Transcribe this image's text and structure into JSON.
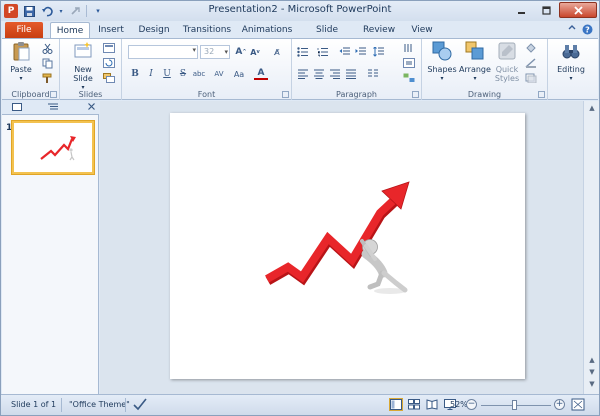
{
  "app": {
    "title": "Presentation2 - Microsoft PowerPoint",
    "logo_letter": "P"
  },
  "tabs": {
    "file": "File",
    "home": "Home",
    "insert": "Insert",
    "design": "Design",
    "transitions": "Transitions",
    "animations": "Animations",
    "slide_show": "Slide Show",
    "review": "Review",
    "view": "View"
  },
  "ribbon": {
    "clipboard": {
      "label": "Clipboard",
      "paste": "Paste"
    },
    "slides": {
      "label": "Slides",
      "new_slide_line1": "New",
      "new_slide_line2": "Slide"
    },
    "font": {
      "label": "Font",
      "size_value": "32"
    },
    "paragraph": {
      "label": "Paragraph"
    },
    "drawing": {
      "label": "Drawing",
      "shapes": "Shapes",
      "arrange": "Arrange",
      "quick_styles_line1": "Quick",
      "quick_styles_line2": "Styles"
    },
    "editing": {
      "label": "Editing"
    }
  },
  "thumbnails": {
    "slide_number": "1"
  },
  "statusbar": {
    "slide_info": "Slide 1 of 1",
    "theme": "\"Office Theme\"",
    "zoom": "52%"
  },
  "colors": {
    "accent_file_tab": "#d24726",
    "arrow_red": "#e8262a",
    "selection_gold": "#f3c250"
  }
}
